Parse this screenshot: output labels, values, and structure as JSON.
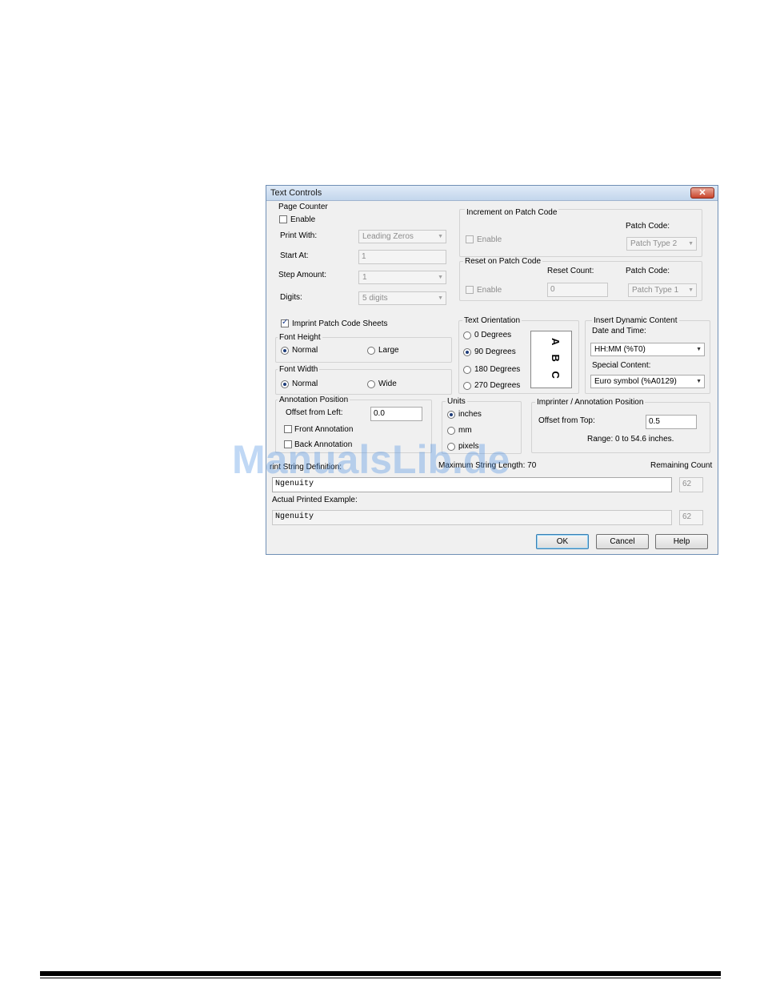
{
  "dialog": {
    "title": "Text Controls",
    "close_glyph": "✕"
  },
  "page_counter": {
    "group": "Page Counter",
    "enable": "Enable",
    "print_with_label": "Print With:",
    "print_with_value": "Leading Zeros",
    "start_at_label": "Start At:",
    "start_at_value": "1",
    "step_label": "Step Amount:",
    "step_value": "1",
    "digits_label": "Digits:",
    "digits_value": "5 digits"
  },
  "increment_patch": {
    "group": "Increment on Patch Code",
    "enable": "Enable",
    "patch_code_label": "Patch Code:",
    "patch_code_value": "Patch Type 2"
  },
  "reset_patch": {
    "group": "Reset on Patch Code",
    "enable": "Enable",
    "reset_count_label": "Reset Count:",
    "reset_count_value": "0",
    "patch_code_label": "Patch Code:",
    "patch_code_value": "Patch Type 1"
  },
  "imprint_sheets": "Imprint Patch Code Sheets",
  "font_height": {
    "group": "Font Height",
    "normal": "Normal",
    "large": "Large"
  },
  "font_width": {
    "group": "Font Width",
    "normal": "Normal",
    "wide": "Wide"
  },
  "orientation": {
    "group": "Text Orientation",
    "options": [
      "0 Degrees",
      "90 Degrees",
      "180 Degrees",
      "270 Degrees"
    ],
    "selected": "90 Degrees",
    "preview": "A B C"
  },
  "dynamic": {
    "group": "Insert Dynamic Content",
    "date_label": "Date and Time:",
    "date_value": "HH:MM (%T0)",
    "special_label": "Special Content:",
    "special_value": "Euro symbol (%A0129)"
  },
  "annotation": {
    "group": "Annotation Position",
    "offset_label": "Offset from Left:",
    "offset_value": "0.0",
    "front": "Front Annotation",
    "back": "Back Annotation"
  },
  "units": {
    "group": "Units",
    "inches": "inches",
    "mm": "mm",
    "pixels": "pixels"
  },
  "imprinter": {
    "group": "Imprinter / Annotation Position",
    "offset_label": "Offset from Top:",
    "offset_value": "0.5",
    "range": "Range: 0 to 54.6 inches."
  },
  "string_def": {
    "label": "rint String Definition:",
    "max_len": "Maximum String Length: 70",
    "remaining_label": "Remaining Count",
    "value": "Ngenuity",
    "remaining": "62"
  },
  "printed_example": {
    "label": "Actual Printed Example:",
    "value": "Ngenuity",
    "count": "62"
  },
  "buttons": {
    "ok": "OK",
    "cancel": "Cancel",
    "help": "Help"
  },
  "watermark": "ManualsLib.de",
  "colors": {
    "title_bar": "#c3d6ec",
    "close": "#c9452c",
    "dialog_bg": "#f0f0f0",
    "watermark": "#4a90e2"
  }
}
